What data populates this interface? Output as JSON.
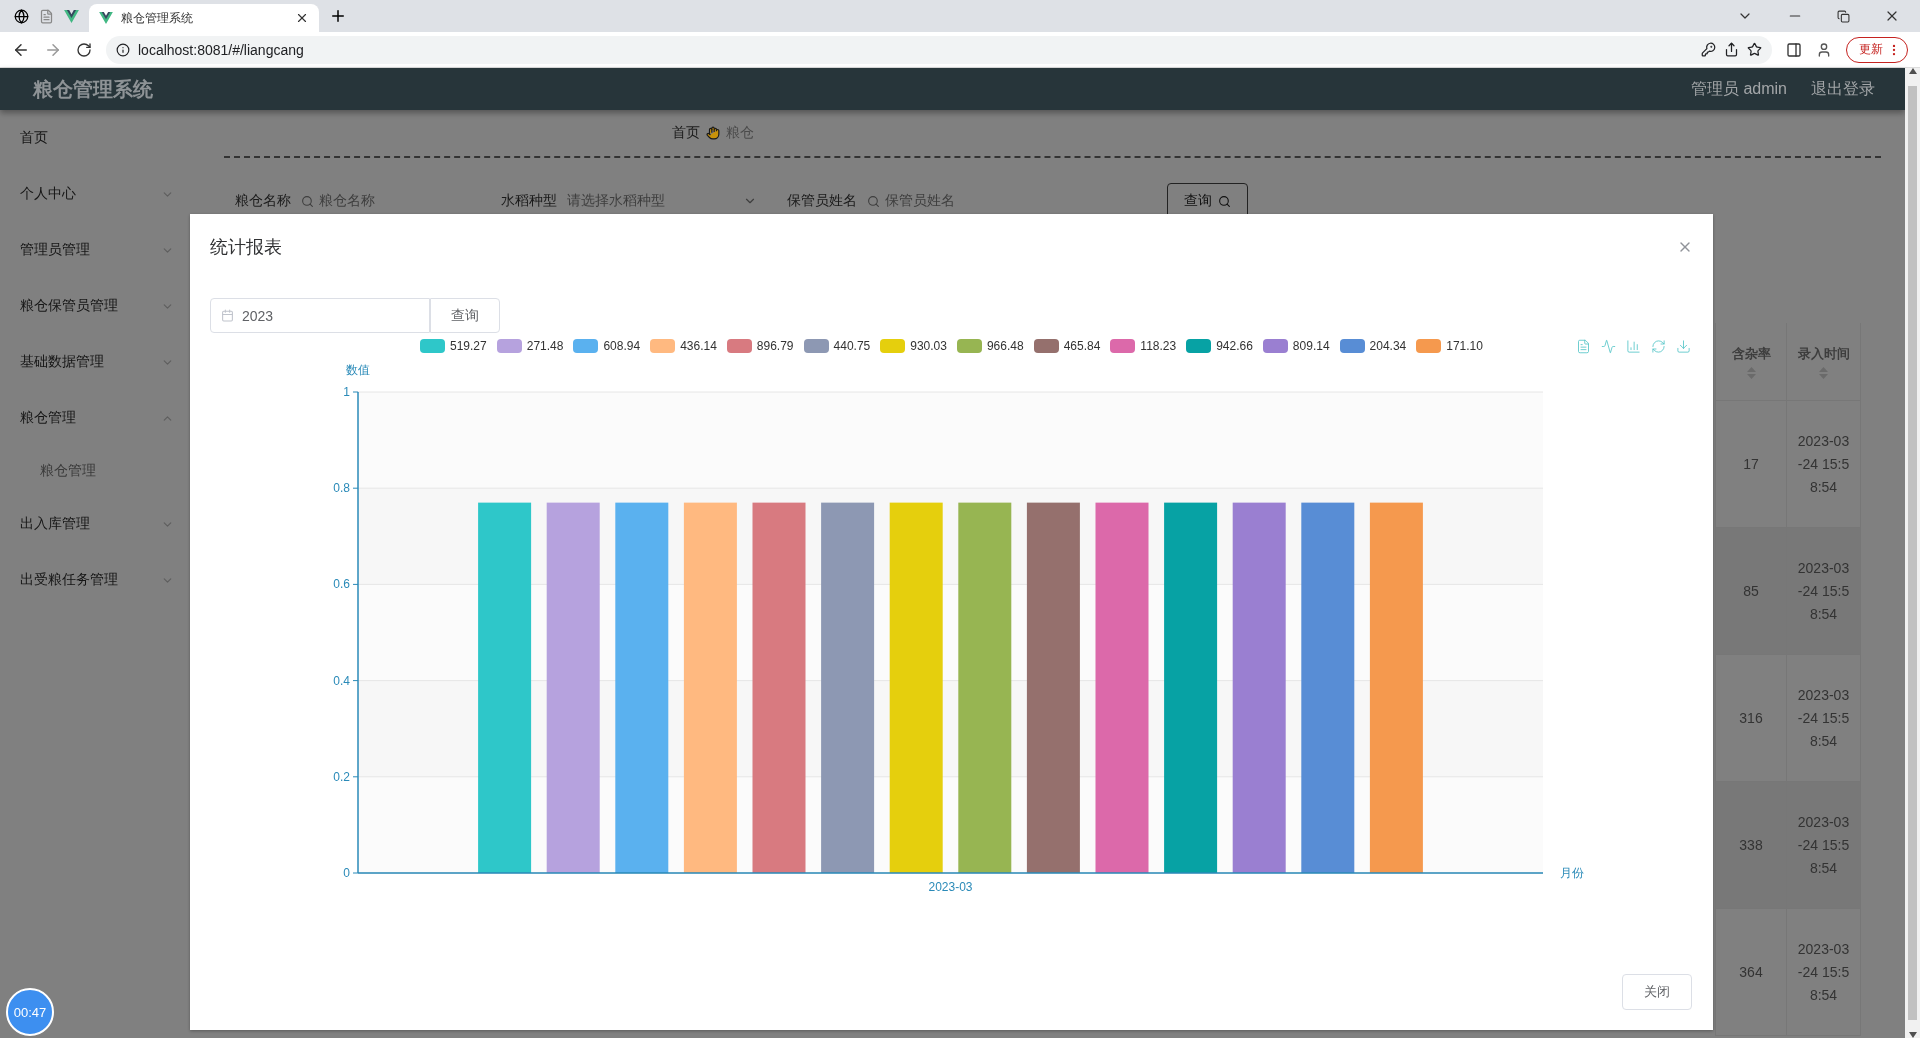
{
  "browser": {
    "tab_title": "粮仓管理系统",
    "url": "localhost:8081/#/liangcang",
    "update_button": "更新"
  },
  "app": {
    "title": "粮仓管理系统",
    "user": "管理员 admin",
    "logout": "退出登录"
  },
  "sidebar": {
    "items": [
      {
        "label": "首页",
        "kind": "link"
      },
      {
        "label": "个人中心",
        "kind": "menu",
        "expanded": false
      },
      {
        "label": "管理员管理",
        "kind": "menu",
        "expanded": false
      },
      {
        "label": "粮仓保管员管理",
        "kind": "menu",
        "expanded": false
      },
      {
        "label": "基础数据管理",
        "kind": "menu",
        "expanded": false
      },
      {
        "label": "粮仓管理",
        "kind": "menu",
        "expanded": true,
        "children": [
          {
            "label": "粮仓管理"
          }
        ]
      },
      {
        "label": "出入库管理",
        "kind": "menu",
        "expanded": false
      },
      {
        "label": "出受粮任务管理",
        "kind": "menu",
        "expanded": false
      }
    ]
  },
  "breadcrumb": [
    "首页",
    "粮仓"
  ],
  "search_form": {
    "fields": [
      {
        "label": "粮仓名称",
        "placeholder": "粮仓名称",
        "kind": "text"
      },
      {
        "label": "水稻种型",
        "placeholder": "请选择水稻种型",
        "kind": "select"
      },
      {
        "label": "保管员姓名",
        "placeholder": "保管员姓名",
        "kind": "text"
      }
    ],
    "button": "查询"
  },
  "table": {
    "columns": [
      "含杂率",
      "录入时间"
    ],
    "rows": [
      [
        "17",
        "2023-03-24 15:58:54"
      ],
      [
        "85",
        "2023-03-24 15:58:54"
      ],
      [
        "316",
        "2023-03-24 15:58:54"
      ],
      [
        "338",
        "2023-03-24 15:58:54"
      ],
      [
        "364",
        "2023-03-24 15:58:54"
      ]
    ]
  },
  "dialog": {
    "title": "统计报表",
    "date_value": "2023",
    "query_button": "查询",
    "close_button": "关闭",
    "chart_data": {
      "type": "bar",
      "ylabel": "数值",
      "xlabel": "月份",
      "categories": [
        "2023-03"
      ],
      "grid": true,
      "ylim": [
        0,
        1
      ],
      "yticks": [
        0,
        0.2,
        0.4,
        0.6,
        0.8,
        1
      ],
      "series": [
        {
          "name": "519.27",
          "color": "#2ec7c9",
          "values": [
            0.77
          ]
        },
        {
          "name": "271.48",
          "color": "#b6a2de",
          "values": [
            0.77
          ]
        },
        {
          "name": "608.94",
          "color": "#5ab1ef",
          "values": [
            0.77
          ]
        },
        {
          "name": "436.14",
          "color": "#ffb980",
          "values": [
            0.77
          ]
        },
        {
          "name": "896.79",
          "color": "#d87a80",
          "values": [
            0.77
          ]
        },
        {
          "name": "440.75",
          "color": "#8d98b3",
          "values": [
            0.77
          ]
        },
        {
          "name": "930.03",
          "color": "#e5cf0d",
          "values": [
            0.77
          ]
        },
        {
          "name": "966.48",
          "color": "#97b552",
          "values": [
            0.77
          ]
        },
        {
          "name": "465.84",
          "color": "#95706d",
          "values": [
            0.77
          ]
        },
        {
          "name": "118.23",
          "color": "#dc69aa",
          "values": [
            0.77
          ]
        },
        {
          "name": "942.66",
          "color": "#07a2a4",
          "values": [
            0.77
          ]
        },
        {
          "name": "809.14",
          "color": "#9a7fd1",
          "values": [
            0.77
          ]
        },
        {
          "name": "204.34",
          "color": "#588dd5",
          "values": [
            0.77
          ]
        },
        {
          "name": "171.10",
          "color": "#f5994e",
          "values": [
            0.77
          ]
        }
      ]
    }
  },
  "timer": "00:47"
}
